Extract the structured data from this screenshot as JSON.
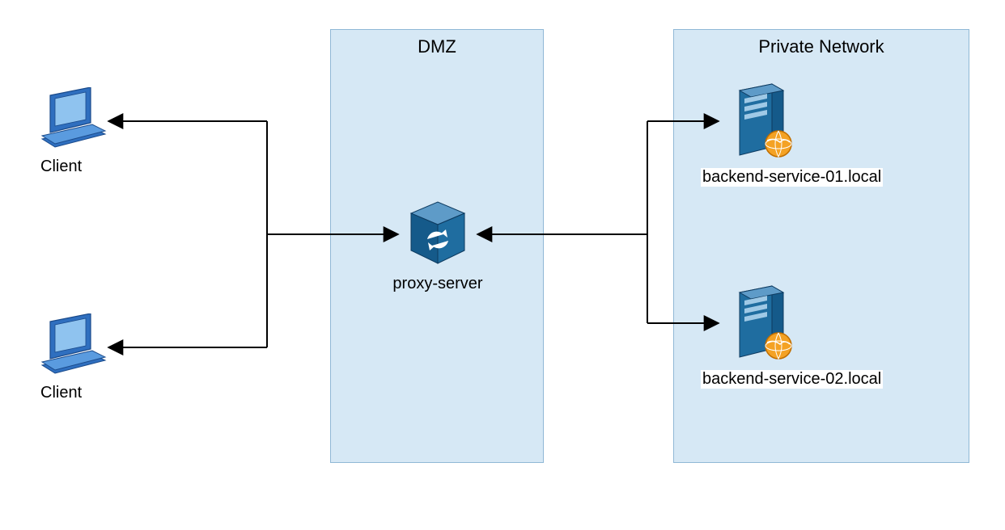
{
  "clients": [
    {
      "label": "Client"
    },
    {
      "label": "Client"
    }
  ],
  "dmz": {
    "title": "DMZ",
    "proxy_label": "proxy-server"
  },
  "private_network": {
    "title": "Private Network",
    "backends": [
      {
        "label": "backend-service-01.local"
      },
      {
        "label": "backend-service-02.local"
      }
    ]
  }
}
